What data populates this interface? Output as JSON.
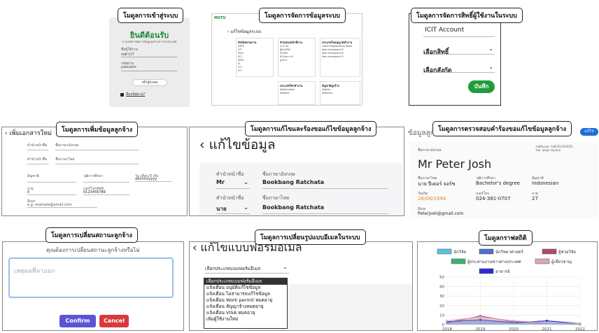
{
  "captions": {
    "login": "โมดูลการเข้าสู่ระบบ",
    "manage_data": "โมดูลการจัดการข้อมูลระบบ",
    "permissions": "โมดูลการจัดการสิทธิ์ผู้ใช้งานในระบบ",
    "add_employee": "โมดูลการเพิ่มข้อมูลลูกจ้าง",
    "edit_request": "โมดูลการแก้ไขและร้องขอแก้ไขข้อมูลลูกจ้าง",
    "review_request": "โมดูลการตรวจสอบคำร้องขอแก้ไขข้อมูลลูกจ้าง",
    "change_status": "โมดูลการเปลี่ยนสถานะลูกจ้าง",
    "email_template": "โมดูลการเปลี่ยนรูปแบบอีเมลในระบบ",
    "statistics": "โมดูลกราฟสถิติ"
  },
  "login": {
    "welcome": "ยินดีต้อนรับ",
    "subtitle": "ระบบบริหารจัดการข้อมูลลูกจ้างชาวต่างประเทศ",
    "username_label": "ชื่อผู้ใช้งาน",
    "username_value": "ปนต์ ICIT",
    "password_label": "รหัสผ่าน",
    "password_value": "pakkadee",
    "login_button": "เข้าสู่ระบบ",
    "forgot_link": "ลืมรหัสผ่าน?"
  },
  "manage": {
    "back_label": "แก้ไขข้อมูลระบบ",
    "panels": [
      {
        "title": "สังกัดหน่วยงาน",
        "items": [
          "ARTS",
          "ICT",
          "ENG",
          "SCI",
          "MED",
          "IC",
          "ICT",
          "ICT"
        ]
      },
      {
        "title": "ตำแหน่งหน้าที่งาน",
        "items": [
          "อาจารย์",
          "ผู้ช่วยวิจัย",
          "นักวิจัย",
          "นักวิเคราะห์",
          "ลูกจ้าง"
        ]
      },
      {
        "title": "ประเภทใบอนุญาตทำงาน",
        "items": [
          "Labor Registration Book",
          "Non-Immigrant B",
          "Non-Immigrant B",
          "Non-Immigrant O"
        ]
      },
      {
        "title": "ประเภทวีซ่าทำงาน",
        "items": [
          "Afghanistan",
          "Albania"
        ]
      },
      {
        "title": "สัญชาติลูกจ้าง",
        "items": [
          "Afghan",
          "Albanian"
        ]
      }
    ]
  },
  "permissions": {
    "account": "ICIT Account",
    "select_role": "เลือกสิทธิ์",
    "select_unit": "เลือกสังกัด",
    "save_button": "บันทึก"
  },
  "add_employee": {
    "header": "เพิ่มเอกสารใหม่",
    "title_label": "คำนำหน้าชื่อ",
    "name_en_label": "ชื่อภาษาอังกฤษ",
    "title_label_th": "คำนำหน้าชื่อ",
    "name_th_label": "ชื่อภาษาไทย",
    "nationality_label": "สัญชาติ",
    "degree_label": "วุฒิการศึกษา",
    "dob_label": "วัน เดือน ปี เกิด",
    "dob_placeholder": "dd/mm/yyyy",
    "age_label": "อายุ",
    "age_value": "0",
    "phone_label": "เบอร์โทรศัพท์",
    "phone_value": "0123456789",
    "email_label": "อีเมล",
    "email_placeholder": "e.g. example@email.com"
  },
  "edit_request": {
    "header": "แก้ไขข้อมูล",
    "title_label_en": "คำนำหน้าชื่อ",
    "name_en_label": "ชื่อภาษาอังกฤษ",
    "title_value_en": "Mr",
    "name_en_value": "Bookbang Ratchata",
    "title_label_th": "คำนำหน้าชื่อ",
    "name_th_label": "ชื่อภาษาไทย",
    "title_value_th": "นาย",
    "name_th_value": "Bookbang Ratchata"
  },
  "review": {
    "header": "ข้อมูลลูกจ้าง",
    "badge": "แก้ไข",
    "meta": "วันที่ร้องขอ: วันที่ 25/10/2021\nโดย: ปุ่มปุ่ม สกุลสกุล",
    "name_label": "ชื่อภาษาอังกฤษ",
    "name_value": "Mr Peter Josh",
    "name_th_label": "ชื่อภาษาไทย",
    "name_th_value": "นาย ปีเตอร์ จอร์ช",
    "degree_label": "วุฒิการศึกษา",
    "degree_value": "Bachelor's degree",
    "nationality_label": "สัญชาติ",
    "nationality_value": "Indonesian",
    "dob_label": "วันเกิด",
    "dob_value": "28/06/1994",
    "phone_label": "เบอร์โทร",
    "phone_value": "024-381-0707",
    "age_label": "อายุ",
    "age_value": "27",
    "email_label": "อีเมล",
    "email_value": "Peterjosh@gmail.com"
  },
  "status": {
    "question": "คุณต้องการเปลี่ยนสถานะลูกจ้างหรือไม่",
    "reason_placeholder": "เหตุผลที่ลาออก",
    "confirm_button": "Confirm",
    "cancel_button": "Cancel"
  },
  "email": {
    "header": "แก้ไขแบบฟอร์มอีเมล",
    "select_label": "เลือกประเภทแบบฟอร์มอีเมล",
    "options": [
      "เลือกประเภทแบบฟอร์มอีเมล",
      "แจ้งเตือน อนุมัติแก้ไขข้อมูล",
      "แจ้งเตือน ไม่สามารถแก้ไขข้อมูล",
      "แจ้งเตือน Work permit หมดอายุ",
      "แจ้งเตือน สัญญาจ้างหมดอายุ",
      "แจ้งเตือน VISA หมดอายุ",
      "เพิ่มผู้ใช้งานใหม่"
    ]
  },
  "chart_data": {
    "type": "line",
    "x": [
      2018,
      2019,
      2020,
      2021,
      2022
    ],
    "ylim": [
      0,
      50
    ],
    "yticks": [
      0,
      10,
      20,
      30,
      40,
      50
    ],
    "legend": [
      {
        "name": "นักวิจัย",
        "color": "#5bc0de"
      },
      {
        "name": "นักวิทยาศาสตร์",
        "color": "#4a6fd1"
      },
      {
        "name": "ผู้ช่วยวิจัย",
        "color": "#b04a6a"
      },
      {
        "name": "ผู้ประสานงานชาวต่างประเทศ",
        "color": "#3cb371"
      },
      {
        "name": "ผู้เชี่ยวชาญ",
        "color": "#d9a6b8"
      },
      {
        "name": "อาจารย์",
        "color": "#2b2bd6"
      }
    ],
    "series": [
      {
        "name": "ผู้ช่วยวิจัย",
        "color": "#b04a6a",
        "values": [
          2,
          9,
          3,
          2,
          1
        ]
      },
      {
        "name": "อาจารย์",
        "color": "#2b2bd6",
        "values": [
          3,
          5,
          2,
          4,
          1
        ]
      },
      {
        "name": "นักวิจัย",
        "color": "#5bc0de",
        "values": [
          1,
          2,
          1,
          1,
          0
        ]
      },
      {
        "name": "ผู้เชี่ยวชาญ",
        "color": "#d9a6b8",
        "values": [
          4,
          8,
          4,
          2,
          1
        ]
      }
    ]
  }
}
